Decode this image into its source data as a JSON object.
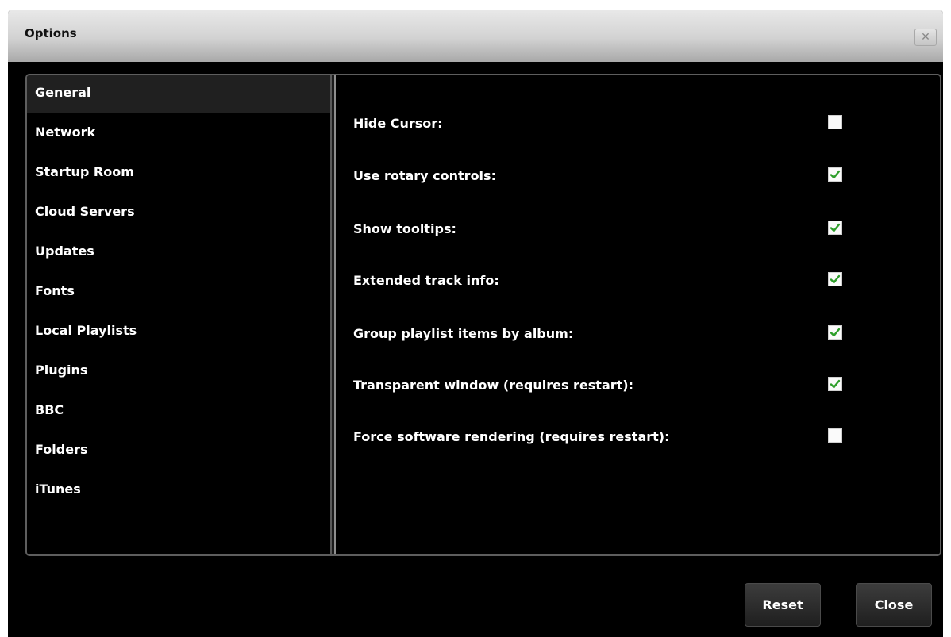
{
  "window": {
    "title": "Options",
    "close_glyph": "✕"
  },
  "sidebar": {
    "items": [
      {
        "label": "General",
        "selected": true
      },
      {
        "label": "Network"
      },
      {
        "label": "Startup Room"
      },
      {
        "label": "Cloud Servers"
      },
      {
        "label": "Updates"
      },
      {
        "label": "Fonts"
      },
      {
        "label": "Local Playlists"
      },
      {
        "label": "Plugins"
      },
      {
        "label": "BBC"
      },
      {
        "label": "Folders"
      },
      {
        "label": "iTunes"
      }
    ]
  },
  "settings": [
    {
      "label": "Hide Cursor:",
      "checked": false
    },
    {
      "label": "Use rotary controls:",
      "checked": true
    },
    {
      "label": "Show tooltips:",
      "checked": true
    },
    {
      "label": "Extended track info:",
      "checked": true
    },
    {
      "label": "Group playlist items by album:",
      "checked": true
    },
    {
      "label": "Transparent window (requires restart):",
      "checked": true
    },
    {
      "label": "Force software rendering (requires restart):",
      "checked": false
    }
  ],
  "buttons": {
    "reset": "Reset",
    "close": "Close"
  },
  "colors": {
    "check": "#2e9e2a",
    "background": "#000000",
    "text": "#ffffff"
  }
}
